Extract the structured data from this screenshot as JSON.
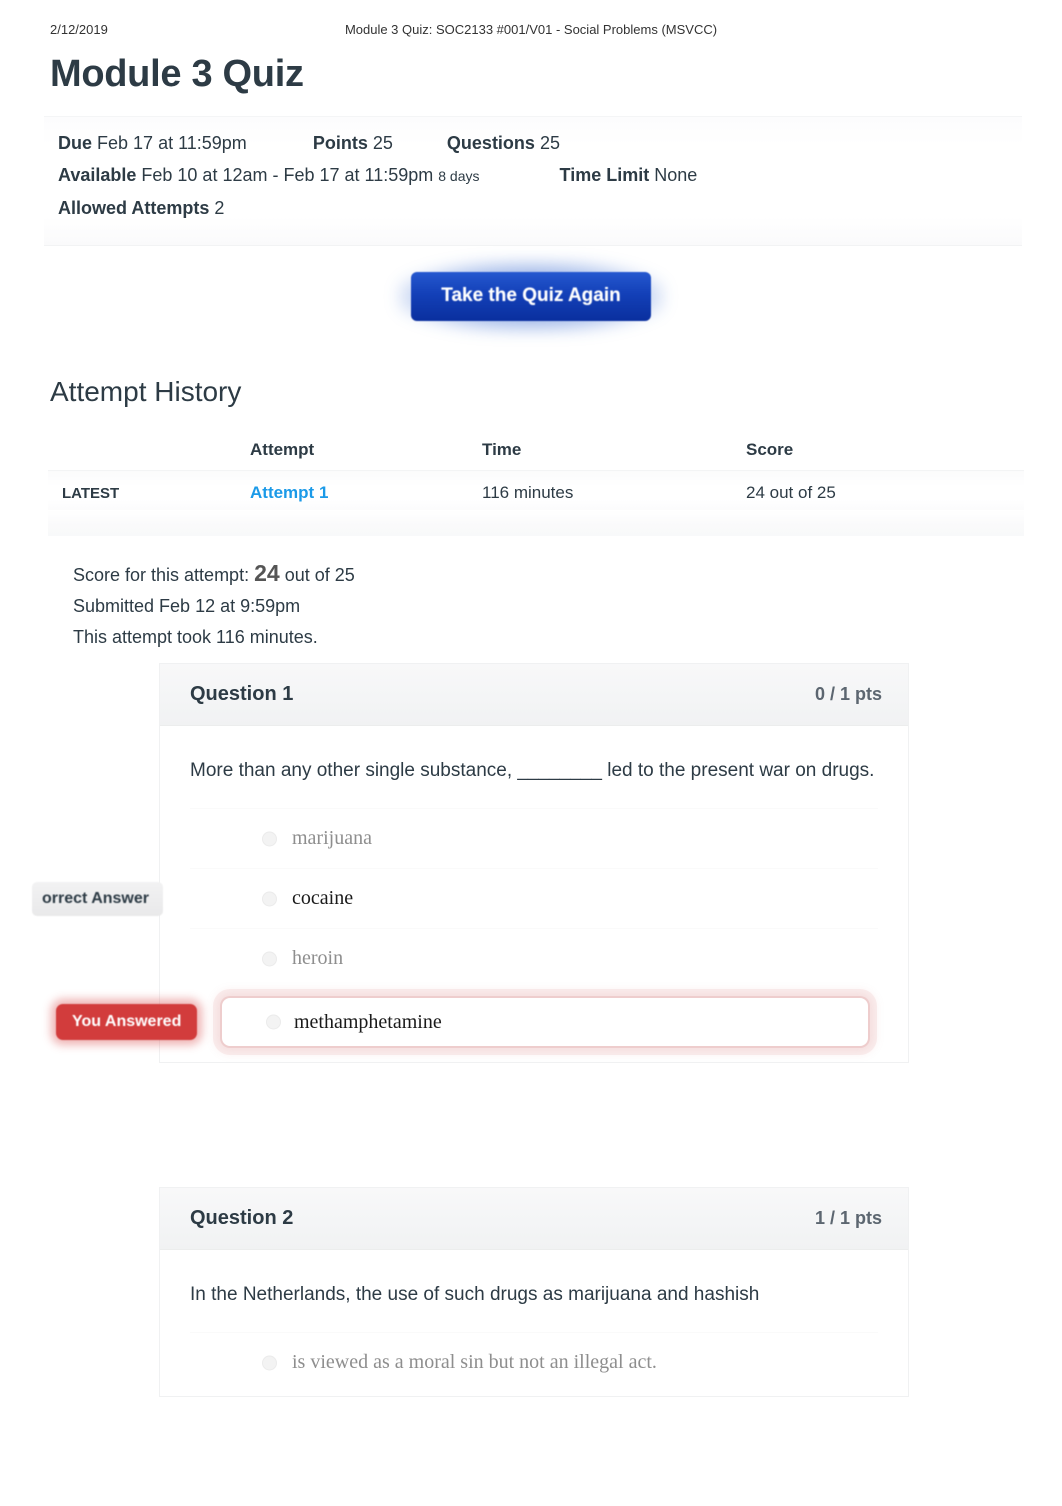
{
  "print_header": {
    "date": "2/12/2019",
    "title": "Module 3 Quiz: SOC2133 #001/V01 - Social Problems (MSVCC)"
  },
  "page_title": "Module 3 Quiz",
  "quiz_details": {
    "due_label": "Due",
    "due_value": "Feb 17 at 11:59pm",
    "points_label": "Points",
    "points_value": "25",
    "questions_label": "Questions",
    "questions_value": "25",
    "available_label": "Available",
    "available_value": "Feb 10 at 12am - Feb 17 at 11:59pm",
    "available_duration": "8 days",
    "time_limit_label": "Time Limit",
    "time_limit_value": "None",
    "allowed_attempts_label": "Allowed Attempts",
    "allowed_attempts_value": "2"
  },
  "actions": {
    "take_quiz_again": "Take the Quiz Again",
    "button_color": "#1340b8"
  },
  "attempt_history": {
    "heading": "Attempt History",
    "columns": [
      "",
      "Attempt",
      "Time",
      "Score"
    ],
    "rows": [
      {
        "kept": "LATEST",
        "attempt": "Attempt 1",
        "time": "116 minutes",
        "score": "24 out of 25",
        "link_color": "#1b9ae8"
      }
    ]
  },
  "attempt_summary": {
    "score_prefix": "Score for this attempt:",
    "score_value": "24",
    "score_suffix": "out of 25",
    "submitted": "Submitted Feb 12 at 9:59pm",
    "duration": "This attempt took 116 minutes."
  },
  "questions": [
    {
      "name": "Question 1",
      "points": "0 / 1 pts",
      "text": "More than any other single substance, ________ led to the present war on drugs.",
      "answers": [
        {
          "label": "marijuana",
          "state": "normal",
          "badge": ""
        },
        {
          "label": "cocaine",
          "state": "correct",
          "badge": "orrect Answer"
        },
        {
          "label": "heroin",
          "state": "normal",
          "badge": ""
        },
        {
          "label": "methamphetamine",
          "state": "chosen",
          "badge": "You Answered"
        }
      ]
    },
    {
      "name": "Question 2",
      "points": "1 / 1 pts",
      "text": "In the Netherlands, the use of such drugs as marijuana and hashish",
      "answers": [
        {
          "label": "is viewed as a moral sin but not an illegal act.",
          "state": "normal",
          "badge": ""
        }
      ]
    }
  ]
}
